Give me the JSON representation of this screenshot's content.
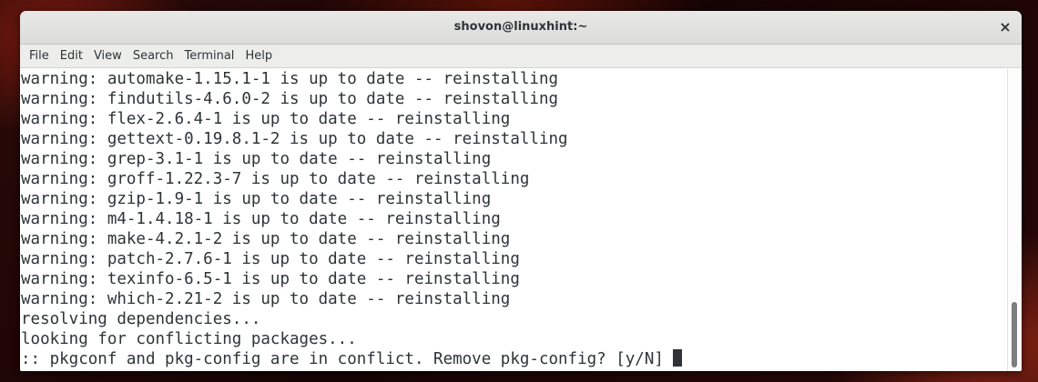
{
  "window": {
    "title": "shovon@linuxhint:~",
    "close_label": "×"
  },
  "menu": {
    "items": [
      "File",
      "Edit",
      "View",
      "Search",
      "Terminal",
      "Help"
    ]
  },
  "terminal": {
    "lines": [
      "warning: automake-1.15.1-1 is up to date -- reinstalling",
      "warning: findutils-4.6.0-2 is up to date -- reinstalling",
      "warning: flex-2.6.4-1 is up to date -- reinstalling",
      "warning: gettext-0.19.8.1-2 is up to date -- reinstalling",
      "warning: grep-3.1-1 is up to date -- reinstalling",
      "warning: groff-1.22.3-7 is up to date -- reinstalling",
      "warning: gzip-1.9-1 is up to date -- reinstalling",
      "warning: m4-1.4.18-1 is up to date -- reinstalling",
      "warning: make-4.2.1-2 is up to date -- reinstalling",
      "warning: patch-2.7.6-1 is up to date -- reinstalling",
      "warning: texinfo-6.5-1 is up to date -- reinstalling",
      "warning: which-2.21-2 is up to date -- reinstalling",
      "resolving dependencies...",
      "looking for conflicting packages..."
    ],
    "prompt": ":: pkgconf and pkg-config are in conflict. Remove pkg-config? [y/N] "
  },
  "colors": {
    "text": "#2e3436",
    "background": "#ffffff",
    "titlebar": "#dcdcdb"
  }
}
